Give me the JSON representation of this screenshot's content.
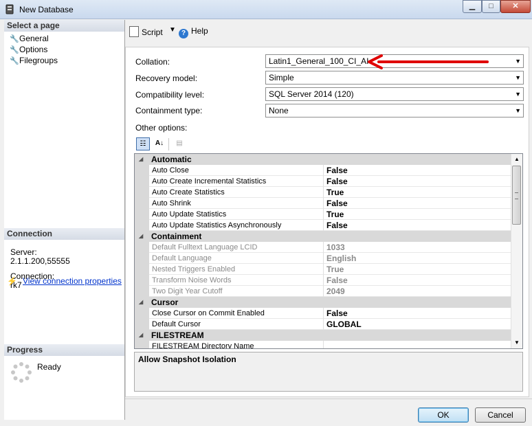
{
  "window": {
    "title": "New Database",
    "minimize_glyph": "▁",
    "maximize_glyph": "□",
    "close_glyph": "✕"
  },
  "left_panel": {
    "select_page_header": "Select a page",
    "pages": [
      {
        "label": "General",
        "icon": "wrench-icon"
      },
      {
        "label": "Options",
        "icon": "wrench-icon"
      },
      {
        "label": "Filegroups",
        "icon": "wrench-icon"
      }
    ],
    "connection_header": "Connection",
    "server_label": "Server:",
    "server_value": "2.1.1.200,55555",
    "connection_label": "Connection:",
    "connection_value": "rk7",
    "view_connection_link": "View connection properties",
    "progress_header": "Progress",
    "progress_status": "Ready"
  },
  "toolbar": {
    "script_label": "Script",
    "help_label": "Help"
  },
  "form": {
    "collation_label": "Collation:",
    "collation_value": "Latin1_General_100_CI_AI",
    "recovery_label": "Recovery model:",
    "recovery_value": "Simple",
    "compat_label": "Compatibility level:",
    "compat_value": "SQL Server 2014 (120)",
    "containment_label": "Containment type:",
    "containment_value": "None",
    "other_options_label": "Other options:"
  },
  "annotation": {
    "arrow_color": "#e00000"
  },
  "property_grid": {
    "categories": [
      {
        "name": "Automatic",
        "rows": [
          {
            "name": "Auto Close",
            "value": "False",
            "disabled": false
          },
          {
            "name": "Auto Create Incremental Statistics",
            "value": "False",
            "disabled": false
          },
          {
            "name": "Auto Create Statistics",
            "value": "True",
            "disabled": false
          },
          {
            "name": "Auto Shrink",
            "value": "False",
            "disabled": false
          },
          {
            "name": "Auto Update Statistics",
            "value": "True",
            "disabled": false
          },
          {
            "name": "Auto Update Statistics Asynchronously",
            "value": "False",
            "disabled": false
          }
        ]
      },
      {
        "name": "Containment",
        "rows": [
          {
            "name": "Default Fulltext Language LCID",
            "value": "1033",
            "disabled": true
          },
          {
            "name": "Default Language",
            "value": "English",
            "disabled": true
          },
          {
            "name": "Nested Triggers Enabled",
            "value": "True",
            "disabled": true
          },
          {
            "name": "Transform Noise Words",
            "value": "False",
            "disabled": true
          },
          {
            "name": "Two Digit Year Cutoff",
            "value": "2049",
            "disabled": true
          }
        ]
      },
      {
        "name": "Cursor",
        "rows": [
          {
            "name": "Close Cursor on Commit Enabled",
            "value": "False",
            "disabled": false
          },
          {
            "name": "Default Cursor",
            "value": "GLOBAL",
            "disabled": false
          }
        ]
      },
      {
        "name": "FILESTREAM",
        "rows": [
          {
            "name": "FILESTREAM Directory Name",
            "value": "",
            "disabled": false
          }
        ]
      }
    ],
    "description_title": "Allow Snapshot Isolation"
  },
  "buttons": {
    "ok": "OK",
    "cancel": "Cancel"
  }
}
